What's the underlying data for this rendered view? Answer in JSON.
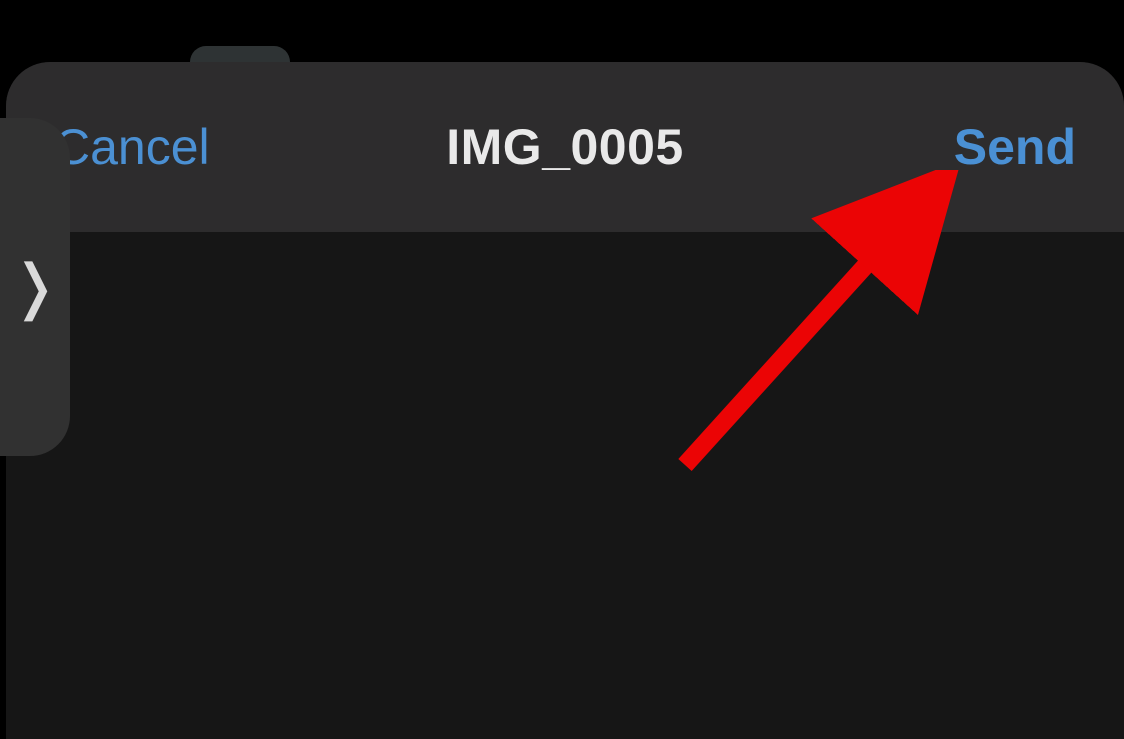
{
  "colors": {
    "link": "#4a90d4",
    "text": "#e9e9e9",
    "sheet_bg": "#161616",
    "navbar_bg": "#2d2c2d",
    "annotation_arrow": "#eb0405"
  },
  "navbar": {
    "cancel_label": "Cancel",
    "title": "IMG_0005",
    "send_label": "Send"
  },
  "side_handle": {
    "glyph": "❭"
  }
}
